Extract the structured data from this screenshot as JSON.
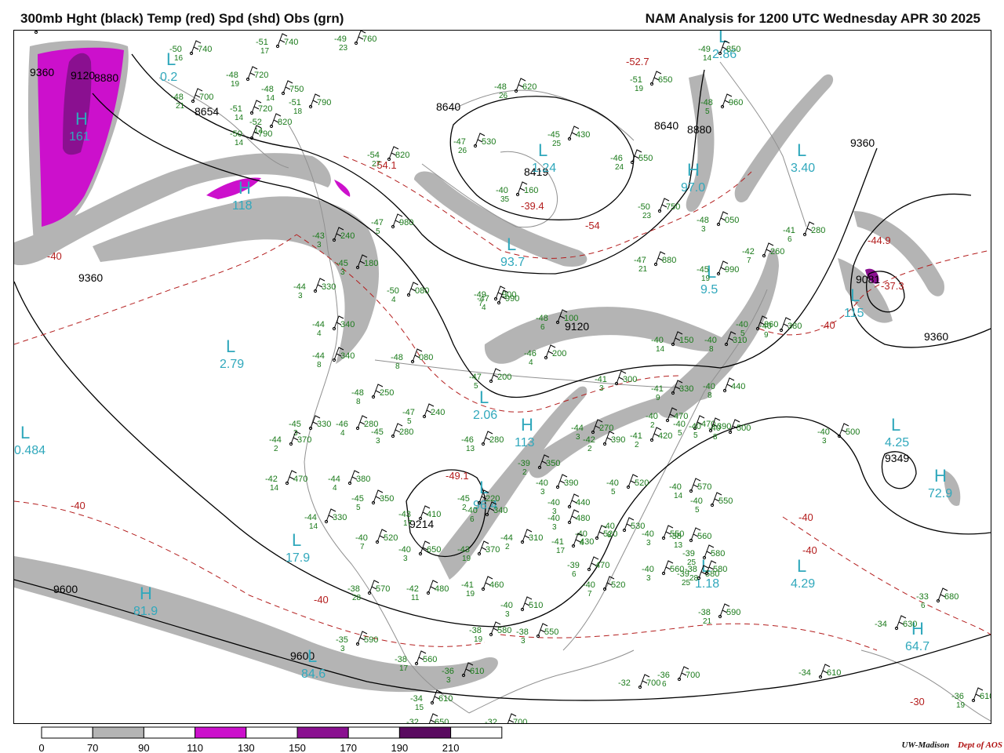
{
  "header": {
    "left_title": "300mb Hght (black) Temp (red) Spd (shd) Obs (grn)",
    "right_title": "NAM Analysis for 1200 UTC Wednesday  APR 30 2025"
  },
  "colors": {
    "height_contour": "#000000",
    "temp_contour": "#b41e1e",
    "obs": "#1a7a1a",
    "pressure_centers": "#30a8bc",
    "speed_70_90": "#b4b4b4",
    "speed_110_130": "#cc10cc",
    "speed_150_170": "#8a1090",
    "speed_190_210": "#5a0a60",
    "geography": "#909090"
  },
  "height_labels": [
    {
      "text": "9360"
    },
    {
      "text": "9120"
    },
    {
      "text": "8880"
    },
    {
      "text": "8654"
    },
    {
      "text": "8640"
    },
    {
      "text": "8419"
    },
    {
      "text": "8640"
    },
    {
      "text": "8880"
    },
    {
      "text": "9360"
    },
    {
      "text": "9360"
    },
    {
      "text": "9120"
    },
    {
      "text": "9360"
    },
    {
      "text": "9081"
    },
    {
      "text": "9349"
    },
    {
      "text": "9214"
    },
    {
      "text": "9600"
    },
    {
      "text": "9600"
    }
  ],
  "temp_labels": [
    {
      "text": "-40"
    },
    {
      "text": "-54.1"
    },
    {
      "text": "-52.7"
    },
    {
      "text": "-54"
    },
    {
      "text": "-39.4"
    },
    {
      "text": "-44.9"
    },
    {
      "text": "-37.3"
    },
    {
      "text": "-40"
    },
    {
      "text": "-49.1"
    },
    {
      "text": "-40"
    },
    {
      "text": "-40"
    },
    {
      "text": "-40"
    },
    {
      "text": "-40"
    },
    {
      "text": "-30"
    }
  ],
  "centers": [
    {
      "type": "L",
      "value": "0.2"
    },
    {
      "type": "H",
      "value": "161"
    },
    {
      "type": "H",
      "value": "118"
    },
    {
      "type": "L",
      "value": "2.79"
    },
    {
      "type": "L",
      "value": "0.484"
    },
    {
      "type": "L",
      "value": "1.24"
    },
    {
      "type": "L",
      "value": "2.86"
    },
    {
      "type": "H",
      "value": "97.0"
    },
    {
      "type": "L",
      "value": "3.40"
    },
    {
      "type": "L",
      "value": "93.7"
    },
    {
      "type": "L",
      "value": "9.5"
    },
    {
      "type": "L",
      "value": "115"
    },
    {
      "type": "L",
      "value": "2.06"
    },
    {
      "type": "H",
      "value": "113"
    },
    {
      "type": "L",
      "value": "96.4"
    },
    {
      "type": "L",
      "value": "17.9"
    },
    {
      "type": "H",
      "value": "81.9"
    },
    {
      "type": "L",
      "value": "84.6"
    },
    {
      "type": "L",
      "value": "1.18"
    },
    {
      "type": "L",
      "value": "4.29"
    },
    {
      "type": "L",
      "value": "4.25"
    },
    {
      "type": "H",
      "value": "72.9"
    },
    {
      "type": "H",
      "value": "64.7"
    }
  ],
  "observations": [
    {
      "t": "-50",
      "h": "740",
      "d": "16"
    },
    {
      "t": "-51",
      "h": "740",
      "d": "17"
    },
    {
      "t": "-49",
      "h": "760",
      "d": "23"
    },
    {
      "t": "-48",
      "h": "720",
      "d": "19"
    },
    {
      "t": "-48",
      "h": "750",
      "d": "14"
    },
    {
      "t": "-48",
      "h": "700",
      "d": "21"
    },
    {
      "t": "-51",
      "h": "720",
      "d": "14"
    },
    {
      "t": "-51",
      "h": "790",
      "d": "18"
    },
    {
      "t": "-52",
      "h": "820",
      "d": "14"
    },
    {
      "t": "-50",
      "h": "790",
      "d": "14"
    },
    {
      "t": "-48",
      "h": "620",
      "d": "26"
    },
    {
      "t": "-47",
      "h": "530",
      "d": "26"
    },
    {
      "t": "-45",
      "h": "430",
      "d": "25"
    },
    {
      "t": "-46",
      "h": "550",
      "d": "24"
    },
    {
      "t": "-40",
      "h": "160",
      "d": "35"
    },
    {
      "t": "-54",
      "h": "820",
      "d": "27"
    },
    {
      "t": "-49",
      "h": "850",
      "d": "14"
    },
    {
      "t": "-51",
      "h": "650",
      "d": "19"
    },
    {
      "t": "-48",
      "h": "960",
      "d": "5"
    },
    {
      "t": "-50",
      "h": "750",
      "d": "23"
    },
    {
      "t": "-48",
      "h": "050",
      "d": "3"
    },
    {
      "t": "-41",
      "h": "280",
      "d": "6"
    },
    {
      "t": "-42",
      "h": "260",
      "d": "7"
    },
    {
      "t": "-47",
      "h": "880",
      "d": "21"
    },
    {
      "t": "-45",
      "h": "990",
      "d": "19"
    },
    {
      "t": "-47",
      "h": "990",
      "d": "4"
    },
    {
      "t": "-47",
      "h": "980",
      "d": "5"
    },
    {
      "t": "-43",
      "h": "240",
      "d": "3"
    },
    {
      "t": "-45",
      "h": "180",
      "d": "3"
    },
    {
      "t": "-44",
      "h": "330",
      "d": "3"
    },
    {
      "t": "-44",
      "h": "340",
      "d": "4"
    },
    {
      "t": "-44",
      "h": "340",
      "d": "8"
    },
    {
      "t": "-50",
      "h": "080",
      "d": "4"
    },
    {
      "t": "-48",
      "h": "080",
      "d": "8"
    },
    {
      "t": "-49",
      "h": "900",
      "d": "7"
    },
    {
      "t": "-48",
      "h": "100",
      "d": "6"
    },
    {
      "t": "-46",
      "h": "200",
      "d": "4"
    },
    {
      "t": "-47",
      "h": "200",
      "d": "5"
    },
    {
      "t": "-41",
      "h": "300",
      "d": "3"
    },
    {
      "t": "-41",
      "h": "330",
      "d": "9"
    },
    {
      "t": "-40",
      "h": "150",
      "d": "14"
    },
    {
      "t": "-40",
      "h": "310",
      "d": "8"
    },
    {
      "t": "-40",
      "h": "360",
      "d": "5"
    },
    {
      "t": "-40",
      "h": "380",
      "d": "9"
    },
    {
      "t": "-40",
      "h": "440",
      "d": "8"
    },
    {
      "t": "-48",
      "h": "250",
      "d": "8"
    },
    {
      "t": "-47",
      "h": "240",
      "d": "5"
    },
    {
      "t": "-46",
      "h": "280",
      "d": "4"
    },
    {
      "t": "-45",
      "h": "330",
      "d": "3"
    },
    {
      "t": "-45",
      "h": "280",
      "d": "3"
    },
    {
      "t": "-44",
      "h": "370",
      "d": "2"
    },
    {
      "t": "-46",
      "h": "280",
      "d": "13"
    },
    {
      "t": "-44",
      "h": "270",
      "d": "3"
    },
    {
      "t": "-42",
      "h": "390",
      "d": "2"
    },
    {
      "t": "-41",
      "h": "420",
      "d": "2"
    },
    {
      "t": "-40",
      "h": "470",
      "d": "2"
    },
    {
      "t": "-40",
      "h": "470",
      "d": "5"
    },
    {
      "t": "-40",
      "h": "390",
      "d": "5"
    },
    {
      "t": "-40",
      "h": "500",
      "d": "8"
    },
    {
      "t": "-40",
      "h": "500",
      "d": "3"
    },
    {
      "t": "-42",
      "h": "470",
      "d": "14"
    },
    {
      "t": "-44",
      "h": "380",
      "d": "4"
    },
    {
      "t": "-45",
      "h": "350",
      "d": "5"
    },
    {
      "t": "-44",
      "h": "330",
      "d": "14"
    },
    {
      "t": "-43",
      "h": "410",
      "d": "17"
    },
    {
      "t": "-45",
      "h": "220",
      "d": "2"
    },
    {
      "t": "-40",
      "h": "340",
      "d": "6"
    },
    {
      "t": "-39",
      "h": "350",
      "d": "2"
    },
    {
      "t": "-40",
      "h": "390",
      "d": "3"
    },
    {
      "t": "-40",
      "h": "440",
      "d": "3"
    },
    {
      "t": "-40",
      "h": "480",
      "d": "3"
    },
    {
      "t": "-40",
      "h": "520",
      "d": "4"
    },
    {
      "t": "-40",
      "h": "520",
      "d": "5"
    },
    {
      "t": "-40",
      "h": "530",
      "d": "8"
    },
    {
      "t": "-40",
      "h": "550",
      "d": "3"
    },
    {
      "t": "-40",
      "h": "560",
      "d": "3"
    },
    {
      "t": "-40",
      "h": "570",
      "d": "14"
    },
    {
      "t": "-40",
      "h": "550",
      "d": "5"
    },
    {
      "t": "-40",
      "h": "520",
      "d": "7"
    },
    {
      "t": "-40",
      "h": "650",
      "d": "3"
    },
    {
      "t": "-43",
      "h": "370",
      "d": "19"
    },
    {
      "t": "-44",
      "h": "310",
      "d": "2"
    },
    {
      "t": "-41",
      "h": "430",
      "d": "17"
    },
    {
      "t": "-39",
      "h": "470",
      "d": "6"
    },
    {
      "t": "-40",
      "h": "520",
      "d": "7"
    },
    {
      "t": "-38",
      "h": "560",
      "d": "13"
    },
    {
      "t": "-39",
      "h": "580",
      "d": "25"
    },
    {
      "t": "-39",
      "h": "580",
      "d": "25"
    },
    {
      "t": "-38",
      "h": "580",
      "d": "28"
    },
    {
      "t": "-38",
      "h": "570",
      "d": "28"
    },
    {
      "t": "-42",
      "h": "480",
      "d": "11"
    },
    {
      "t": "-41",
      "h": "460",
      "d": "19"
    },
    {
      "t": "-40",
      "h": "510",
      "d": "3"
    },
    {
      "t": "-38",
      "h": "550",
      "d": "3"
    },
    {
      "t": "-38",
      "h": "590",
      "d": "21"
    },
    {
      "t": "-38",
      "h": "580",
      "d": "19"
    },
    {
      "t": "-35",
      "h": "590",
      "d": "3"
    },
    {
      "t": "-38",
      "h": "560",
      "d": "17"
    },
    {
      "t": "-36",
      "h": "610",
      "d": "3"
    },
    {
      "t": "-34",
      "h": "610",
      "d": "15"
    },
    {
      "t": "-32",
      "h": "650",
      "d": "8"
    },
    {
      "t": "-32",
      "h": "700",
      "d": ""
    },
    {
      "t": "-32",
      "h": "700",
      "d": ""
    },
    {
      "t": "-36",
      "h": "700",
      "d": "6"
    },
    {
      "t": "-33",
      "h": "680",
      "d": "6"
    },
    {
      "t": "-34",
      "h": "630",
      "d": ""
    },
    {
      "t": "-34",
      "h": "610",
      "d": ""
    },
    {
      "t": "-36",
      "h": "610",
      "d": "19"
    },
    {
      "t": "-30",
      "h": "680",
      "d": ""
    }
  ],
  "legend": {
    "ticks": [
      "0",
      "70",
      "90",
      "110",
      "130",
      "150",
      "170",
      "190",
      "210"
    ],
    "segment_colors": [
      "#ffffff",
      "#b4b4b4",
      "#ffffff",
      "#cc10cc",
      "#ffffff",
      "#8a1090",
      "#ffffff",
      "#5a0a60",
      "#ffffff"
    ]
  },
  "credit": {
    "org": "UW-Madison",
    "dept": "Dept of AOS"
  }
}
